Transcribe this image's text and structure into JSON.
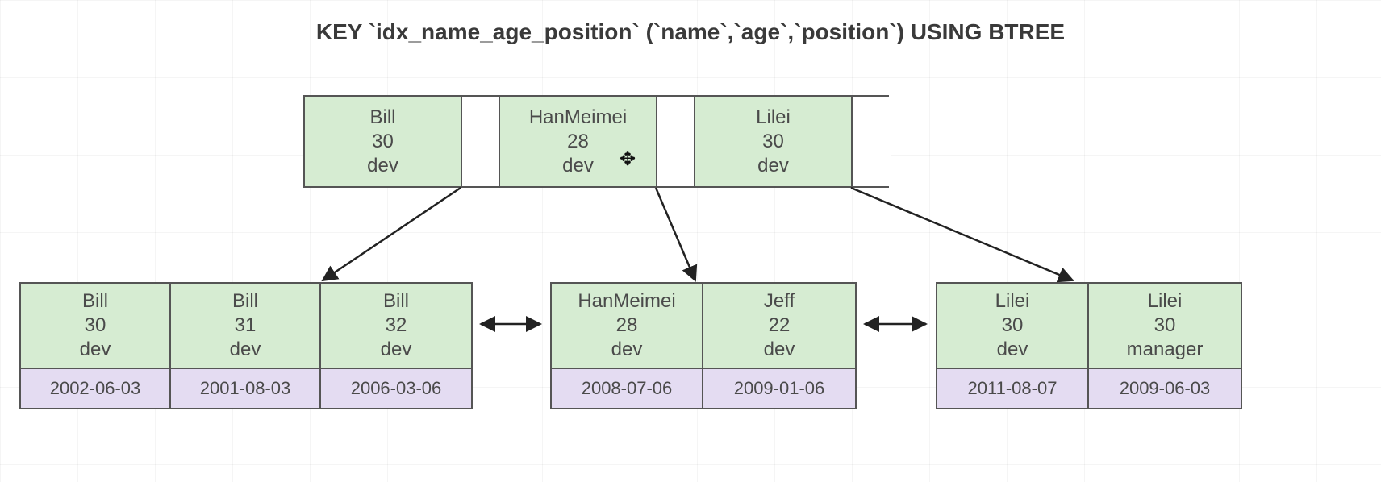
{
  "title": "KEY `idx_name_age_position` (`name`,`age`,`position`) USING BTREE",
  "root": {
    "keys": [
      {
        "name": "Bill",
        "age": "30",
        "position": "dev"
      },
      {
        "name": "HanMeimei",
        "age": "28",
        "position": "dev"
      },
      {
        "name": "Lilei",
        "age": "30",
        "position": "dev"
      }
    ]
  },
  "leaves": [
    {
      "entries": [
        {
          "name": "Bill",
          "age": "30",
          "position": "dev",
          "date": "2002-06-03"
        },
        {
          "name": "Bill",
          "age": "31",
          "position": "dev",
          "date": "2001-08-03"
        },
        {
          "name": "Bill",
          "age": "32",
          "position": "dev",
          "date": "2006-03-06"
        }
      ]
    },
    {
      "entries": [
        {
          "name": "HanMeimei",
          "age": "28",
          "position": "dev",
          "date": "2008-07-06"
        },
        {
          "name": "Jeff",
          "age": "22",
          "position": "dev",
          "date": "2009-01-06"
        }
      ]
    },
    {
      "entries": [
        {
          "name": "Lilei",
          "age": "30",
          "position": "dev",
          "date": "2011-08-07"
        },
        {
          "name": "Lilei",
          "age": "30",
          "position": "manager",
          "date": "2009-06-03"
        }
      ]
    }
  ],
  "colors": {
    "key_fill": "#d6ecd2",
    "value_fill": "#e4dcf2",
    "border": "#555555"
  }
}
